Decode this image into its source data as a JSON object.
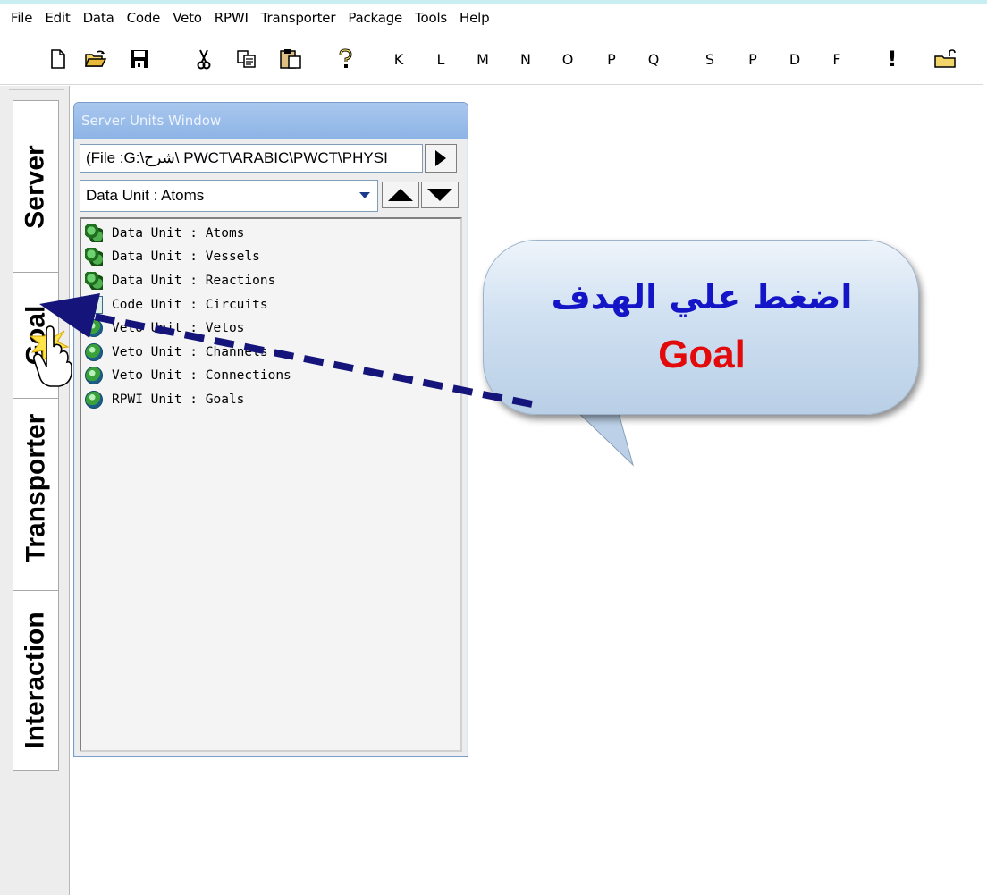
{
  "menu": [
    "File",
    "Edit",
    "Data",
    "Code",
    "Veto",
    "RPWI",
    "Transporter",
    "Package",
    "Tools",
    "Help"
  ],
  "toolbar": {
    "icons": [
      "new-file-icon",
      "open-folder-icon",
      "save-icon",
      "cut-icon",
      "copy-icon",
      "paste-icon",
      "help-icon"
    ],
    "letters": [
      "K",
      "L",
      "M",
      "N",
      "O",
      "P",
      "Q",
      "S",
      "P",
      "D",
      "F"
    ],
    "exclaim": "!",
    "end_icon": "unlock-folder-icon"
  },
  "side_tabs": [
    "Server",
    "Goal",
    "Transporter",
    "Interaction"
  ],
  "server_units_window": {
    "title": "Server Units Window",
    "file_path": "(File :G:\\شرح\\ PWCT\\ARABIC\\PWCT\\PHYSI",
    "selected_unit": "Data Unit : Atoms",
    "list": [
      {
        "label": "Data Unit : Atoms",
        "icon": "data-unit-icon"
      },
      {
        "label": "Data Unit : Vessels",
        "icon": "data-unit-icon"
      },
      {
        "label": "Data Unit : Reactions",
        "icon": "data-unit-icon"
      },
      {
        "label": "Code Unit : Circuits",
        "icon": "code-unit-icon"
      },
      {
        "label": "Veto Unit : Vetos",
        "icon": "globe-icon"
      },
      {
        "label": "Veto Unit : Channels",
        "icon": "globe-icon"
      },
      {
        "label": "Veto Unit : Connections",
        "icon": "globe-icon"
      },
      {
        "label": "RPWI Unit : Goals",
        "icon": "globe-icon"
      }
    ]
  },
  "callout": {
    "arabic": "اضغط علي الهدف",
    "english": "Goal"
  },
  "colors": {
    "callout_arabic": "#1515c8",
    "callout_english": "#e20a0a",
    "arrow": "#14147a",
    "window_title": "#8db4e6"
  }
}
